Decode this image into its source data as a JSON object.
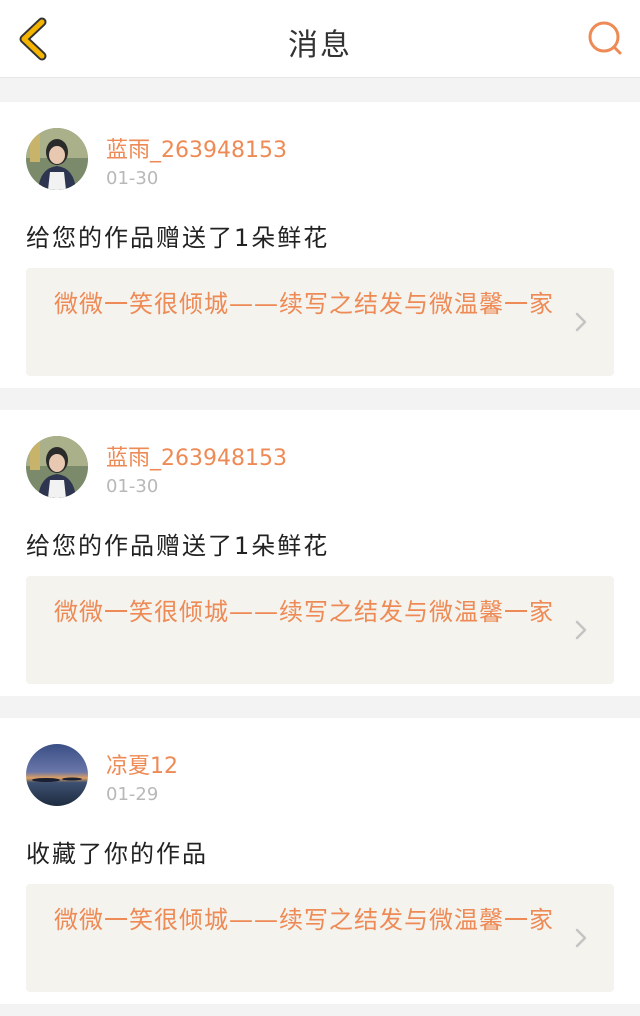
{
  "header": {
    "title": "消息"
  },
  "messages": [
    {
      "username": "蓝雨_263948153",
      "date": "01-30",
      "action": "给您的作品赠送了1朵鲜花",
      "work_title": "微微一笑很倾城——续写之结发与微温馨一家"
    },
    {
      "username": "蓝雨_263948153",
      "date": "01-30",
      "action": "给您的作品赠送了1朵鲜花",
      "work_title": "微微一笑很倾城——续写之结发与微温馨一家"
    },
    {
      "username": "凉夏12",
      "date": "01-29",
      "action": "收藏了你的作品",
      "work_title": "微微一笑很倾城——续写之结发与微温馨一家"
    }
  ],
  "colors": {
    "accent": "#ee8a55",
    "card_link_bg": "#f4f3ee",
    "page_bg": "#f3f3f3"
  }
}
